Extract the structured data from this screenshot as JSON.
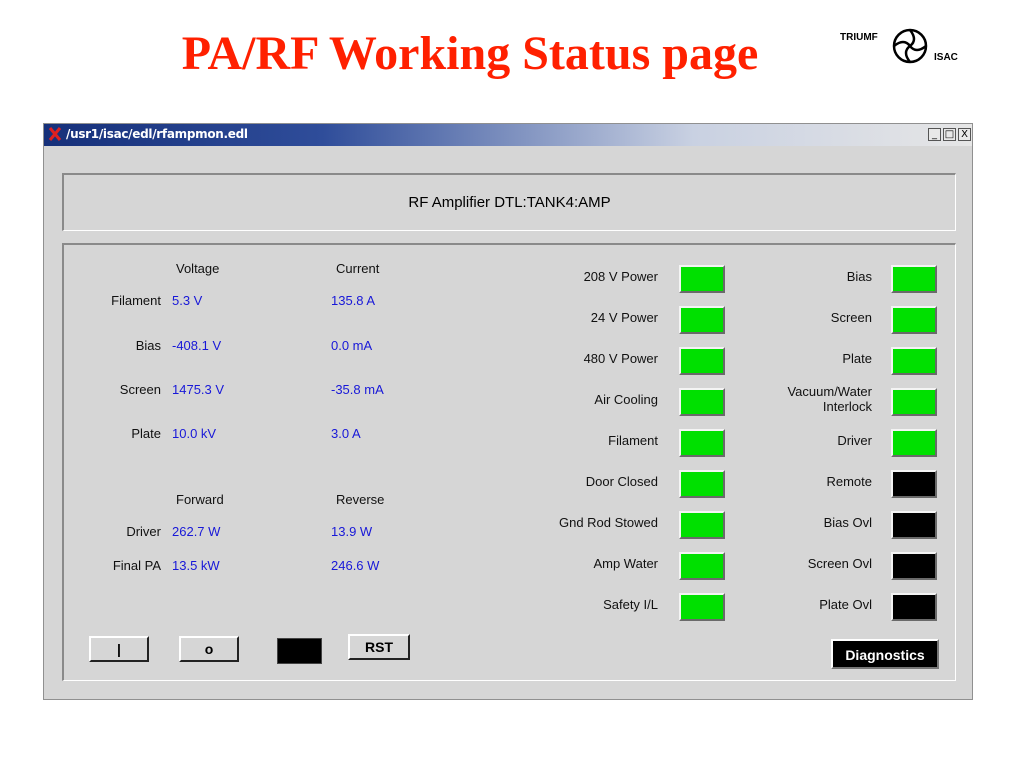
{
  "slide": {
    "title": "PA/RF Working Status page"
  },
  "logo": {
    "left_text": "TRIUMF",
    "right_text": "ISAC"
  },
  "window": {
    "title": "/usr1/isac/edl/rfampmon.edl",
    "controls": {
      "minimize": "_",
      "maximize": "□",
      "close": "X"
    }
  },
  "header": {
    "title": "RF Amplifier DTL:TANK4:AMP"
  },
  "measurements": {
    "headers": {
      "voltage": "Voltage",
      "current": "Current"
    },
    "rows": [
      {
        "label": "Filament",
        "voltage": "5.3 V",
        "current": "135.8 A"
      },
      {
        "label": "Bias",
        "voltage": "-408.1 V",
        "current": "0.0 mA"
      },
      {
        "label": "Screen",
        "voltage": "1475.3 V",
        "current": "-35.8 mA"
      },
      {
        "label": "Plate",
        "voltage": "10.0 kV",
        "current": "3.0 A"
      }
    ]
  },
  "power": {
    "headers": {
      "forward": "Forward",
      "reverse": "Reverse"
    },
    "rows": [
      {
        "label": "Driver",
        "forward": "262.7 W",
        "reverse": "13.9 W"
      },
      {
        "label": "Final PA",
        "forward": "13.5 kW",
        "reverse": "246.6 W"
      }
    ]
  },
  "status_left": [
    {
      "label": "208 V Power",
      "state": "on"
    },
    {
      "label": "24 V Power",
      "state": "on"
    },
    {
      "label": "480 V Power",
      "state": "on"
    },
    {
      "label": "Air Cooling",
      "state": "on"
    },
    {
      "label": "Filament",
      "state": "on"
    },
    {
      "label": "Door Closed",
      "state": "on"
    },
    {
      "label": "Gnd Rod Stowed",
      "state": "on"
    },
    {
      "label": "Amp Water",
      "state": "on"
    },
    {
      "label": "Safety I/L",
      "state": "on"
    }
  ],
  "status_right": [
    {
      "label": "Bias",
      "state": "on"
    },
    {
      "label": "Screen",
      "state": "on"
    },
    {
      "label": "Plate",
      "state": "on"
    },
    {
      "label": "Vacuum/Water",
      "label2": "Interlock",
      "state": "on"
    },
    {
      "label": "Driver",
      "state": "on"
    },
    {
      "label": "Remote",
      "state": "off"
    },
    {
      "label": "Bias Ovl",
      "state": "off"
    },
    {
      "label": "Screen Ovl",
      "state": "off"
    },
    {
      "label": "Plate Ovl",
      "state": "off"
    }
  ],
  "colors": {
    "on": "#00e000",
    "off": "#000000",
    "title": "#ff2000",
    "value": "#1818d8"
  },
  "buttons": {
    "on_label": "|",
    "off_label": "o",
    "reset_label": "RST",
    "diagnostics_label": "Diagnostics"
  }
}
